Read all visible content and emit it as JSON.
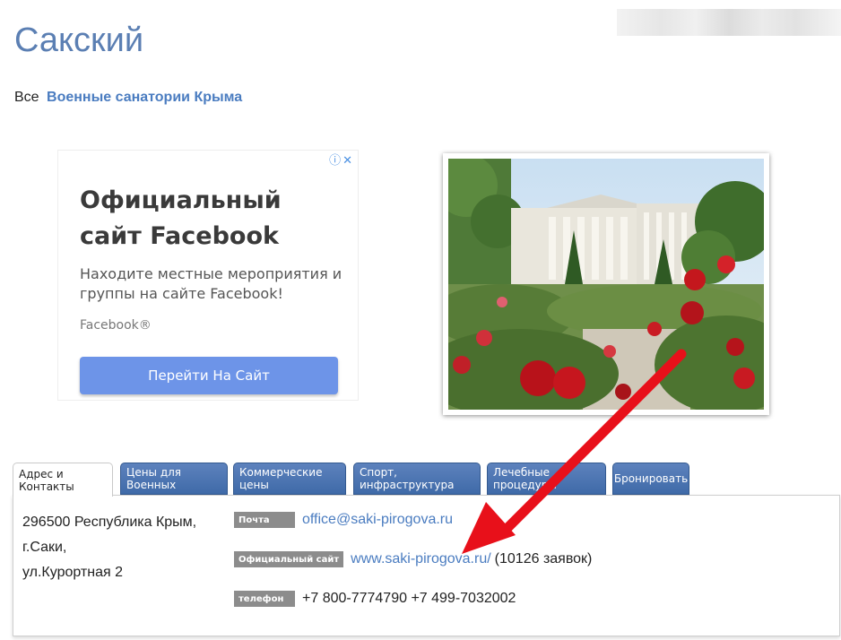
{
  "page": {
    "title": "Сакский"
  },
  "breadcrumb": {
    "prefix": "Все",
    "link": "Военные санатории Крыма"
  },
  "ad": {
    "title": "Официальный сайт Facebook",
    "description": "Находите местные мероприятия и группы на сайте Facebook!",
    "brand": "Facebook®",
    "button": "Перейти На Сайт",
    "icons": [
      "info-icon",
      "close-icon"
    ]
  },
  "tabs": [
    {
      "label": "Адрес и Контакты",
      "active": true
    },
    {
      "label": "Цены для Военных",
      "active": false
    },
    {
      "label": "Коммерческие цены",
      "active": false
    },
    {
      "label": "Спорт, инфраструктура",
      "active": false
    },
    {
      "label": "Лечебные процедуры",
      "active": false
    },
    {
      "label": "Бронировать",
      "active": false
    }
  ],
  "contacts": {
    "address_lines": [
      "296500 Республика Крым,",
      "г.Саки,",
      "ул.Курортная 2"
    ],
    "email_label": "Почта",
    "email": "office@saki-pirogova.ru",
    "site_label": "Официальный сайт",
    "site": "www.saki-pirogova.ru/",
    "site_extra": "(10126 заявок)",
    "phone_label": "телефон",
    "phone": "+7 800-7774790 +7 499-7032002"
  },
  "colors": {
    "title": "#5b7fb3",
    "link": "#4a7cc0",
    "tab_bg": "#4a73b0",
    "arrow": "#e8101a",
    "label_bg": "#8c8c8c"
  }
}
